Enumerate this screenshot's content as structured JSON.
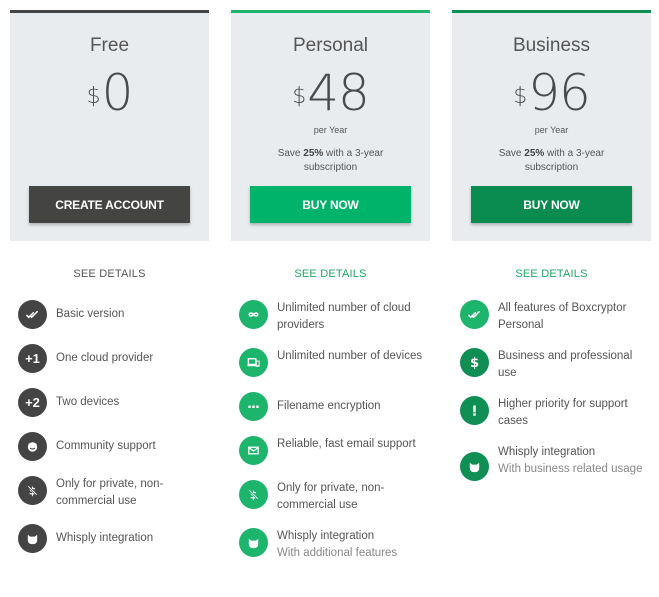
{
  "colors": {
    "free_accent": "#444444",
    "personal_accent": "#1db46c",
    "business_accent": "#0f8f53",
    "card_bg": "#e9ecef"
  },
  "plans": [
    {
      "id": "free",
      "name": "Free",
      "currency": "$",
      "price": "0",
      "period": "",
      "save_prefix": "",
      "save_bold": "",
      "save_suffix": "",
      "cta_label": "CREATE ACCOUNT",
      "details_label": "SEE DETAILS",
      "features": [
        {
          "icon": "double-check-icon",
          "text": "Basic version",
          "sub": ""
        },
        {
          "icon": "plus-one-icon",
          "glyph": "+1",
          "text": "One cloud provider",
          "sub": ""
        },
        {
          "icon": "plus-two-icon",
          "glyph": "+2",
          "text": "Two devices",
          "sub": ""
        },
        {
          "icon": "community-icon",
          "text": "Community support",
          "sub": ""
        },
        {
          "icon": "no-dollar-icon",
          "text": "Only for private, non-commercial use",
          "sub": ""
        },
        {
          "icon": "whisply-icon",
          "text": "Whisply integration",
          "sub": ""
        }
      ]
    },
    {
      "id": "personal",
      "name": "Personal",
      "currency": "$",
      "price": "48",
      "period": "per Year",
      "save_prefix": "Save ",
      "save_bold": "25%",
      "save_suffix": " with a 3-year subscription",
      "cta_label": "BUY NOW",
      "details_label": "SEE DETAILS",
      "features": [
        {
          "icon": "infinity-icon",
          "text": "Unlimited number of cloud providers",
          "sub": ""
        },
        {
          "icon": "devices-icon",
          "text": "Unlimited number of devices",
          "sub": ""
        },
        {
          "icon": "dots-icon",
          "text": "Filename encryption",
          "sub": ""
        },
        {
          "icon": "mail-icon",
          "text": "Reliable, fast email support",
          "sub": ""
        },
        {
          "icon": "no-dollar-icon",
          "text": "Only for private, non-commercial use",
          "sub": ""
        },
        {
          "icon": "whisply-icon",
          "text": "Whisply integration",
          "sub": "With additional features"
        }
      ]
    },
    {
      "id": "business",
      "name": "Business",
      "currency": "$",
      "price": "96",
      "period": "per Year",
      "save_prefix": "Save ",
      "save_bold": "25%",
      "save_suffix": " with a 3-year subscription",
      "cta_label": "BUY NOW",
      "details_label": "SEE DETAILS",
      "features": [
        {
          "icon": "double-check-icon",
          "text": "All features of Boxcryptor Personal",
          "sub": ""
        },
        {
          "icon": "dollar-icon",
          "text": "Business and professional use",
          "sub": ""
        },
        {
          "icon": "exclamation-icon",
          "text": "Higher priority for support cases",
          "sub": ""
        },
        {
          "icon": "whisply-icon",
          "text": "Whisply integration",
          "sub": "With business related usage"
        }
      ]
    }
  ]
}
